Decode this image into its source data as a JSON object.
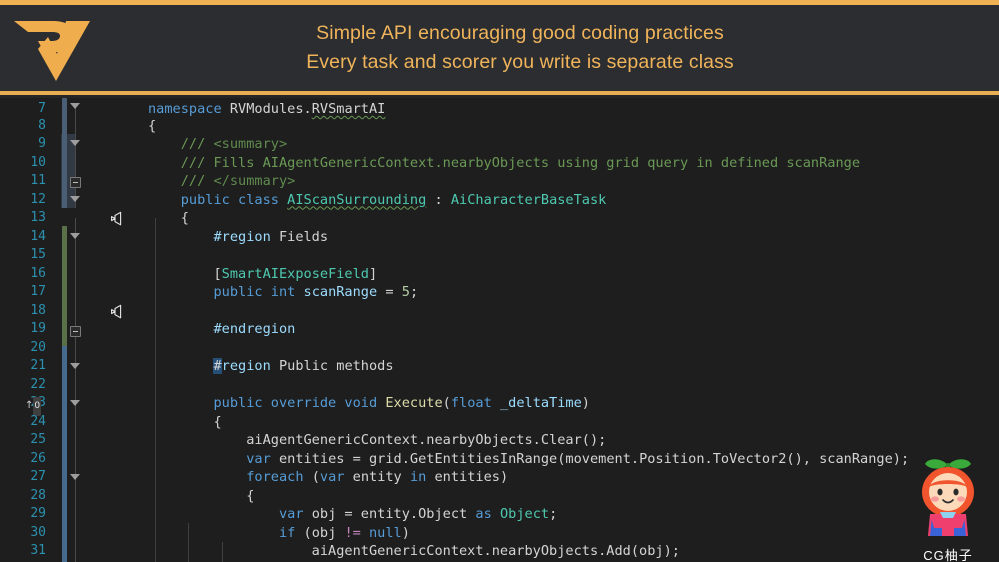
{
  "header": {
    "logo_alt": "RV",
    "tagline_1": "Simple API encouraging good coding practices",
    "tagline_2": "Every task and scorer you write is separate class",
    "accent_color": "#efb152",
    "text_color": "#f0b45a",
    "background": "#2b2d31"
  },
  "watermark": {
    "label": "CG柚子"
  },
  "editor": {
    "background": "#1e1e1e",
    "line_number_color": "#2b91af",
    "default_text_color": "#d4d4d4",
    "first_line": 7,
    "last_line": 31,
    "reference_badge": "0",
    "unity_icon_lines": [
      12,
      17
    ],
    "lines": [
      {
        "n": 7,
        "text": "namespace RVModules.RVSmartAI"
      },
      {
        "n": 8,
        "text": "{"
      },
      {
        "n": 9,
        "text": "    /// <summary>"
      },
      {
        "n": 10,
        "text": "    /// Fills AIAgentGenericContext.nearbyObjects using grid query in defined scanRange"
      },
      {
        "n": 11,
        "text": "    /// </summary>"
      },
      {
        "n": 12,
        "text": "    public class AIScanSurrounding : AiCharacterBaseTask"
      },
      {
        "n": 13,
        "text": "    {"
      },
      {
        "n": 14,
        "text": "        #region Fields"
      },
      {
        "n": 15,
        "text": ""
      },
      {
        "n": 16,
        "text": "        [SmartAIExposeField]"
      },
      {
        "n": 17,
        "text": "        public int scanRange = 5;"
      },
      {
        "n": 18,
        "text": ""
      },
      {
        "n": 19,
        "text": "        #endregion"
      },
      {
        "n": 20,
        "text": ""
      },
      {
        "n": 21,
        "text": "        #region Public methods"
      },
      {
        "n": 22,
        "text": ""
      },
      {
        "n": 23,
        "text": "        public override void Execute(float _deltaTime)"
      },
      {
        "n": 24,
        "text": "        {"
      },
      {
        "n": 25,
        "text": "            aiAgentGenericContext.nearbyObjects.Clear();"
      },
      {
        "n": 26,
        "text": "            var entities = grid.GetEntitiesInRange(movement.Position.ToVector2(), scanRange);"
      },
      {
        "n": 27,
        "text": "            foreach (var entity in entities)"
      },
      {
        "n": 28,
        "text": "            {"
      },
      {
        "n": 29,
        "text": "                var obj = entity.Object as Object;"
      },
      {
        "n": 30,
        "text": "                if (obj != null)"
      },
      {
        "n": 31,
        "text": "                    aiAgentGenericContext.nearbyObjects.Add(obj);"
      }
    ]
  }
}
